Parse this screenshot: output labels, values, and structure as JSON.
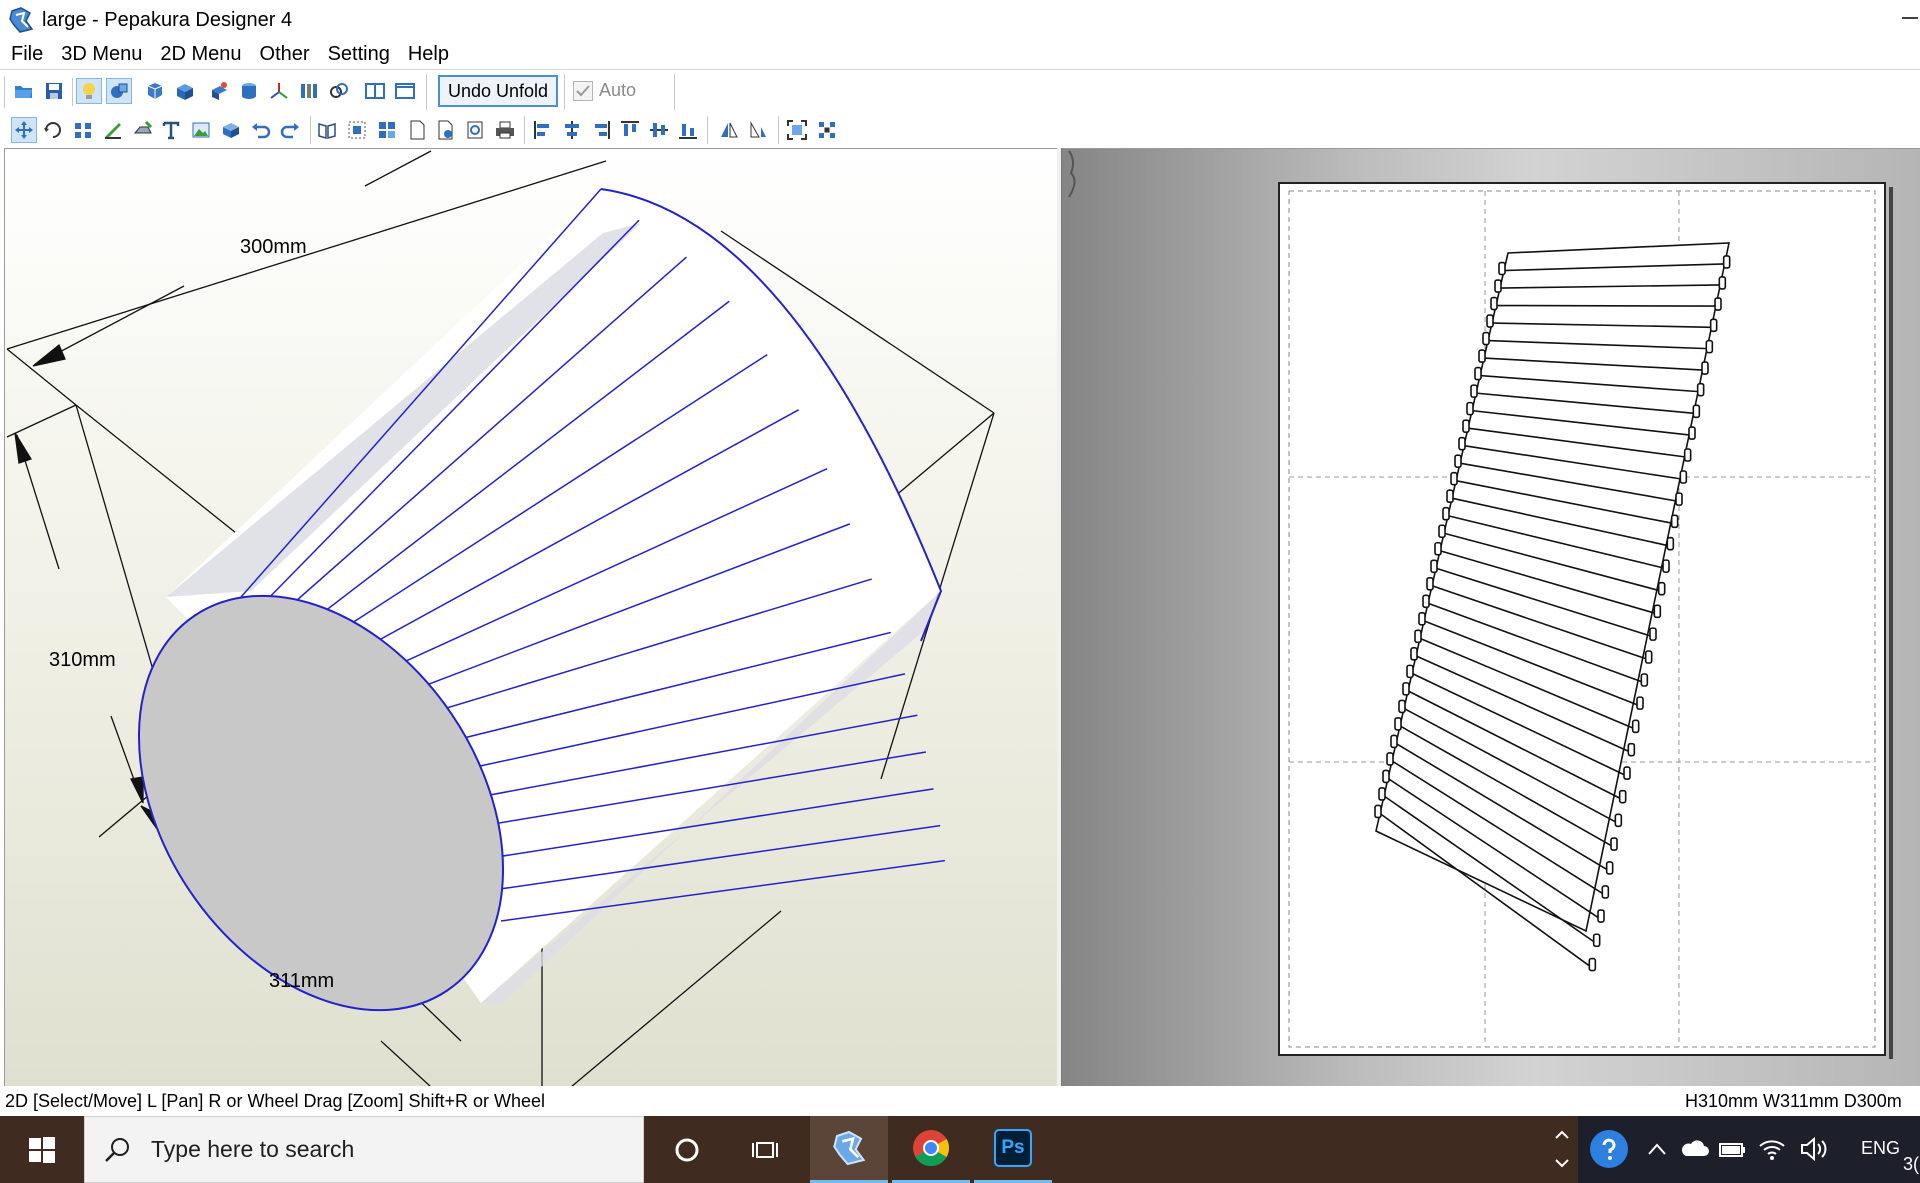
{
  "window": {
    "title": "large - Pepakura Designer 4"
  },
  "menu": [
    "File",
    "3D Menu",
    "2D Menu",
    "Other",
    "Setting",
    "Help"
  ],
  "toolbar1": {
    "undo_unfold_label": "Undo Unfold",
    "auto_label": "Auto",
    "auto_checked": true,
    "icons": [
      "open-icon",
      "save-icon",
      "light-icon",
      "textures-icon",
      "unfold-icon",
      "shading-icon",
      "fold-icon",
      "cylinder-icon",
      "axis-icon",
      "edges-icon",
      "view-link-icon",
      "split-view-icon",
      "single-view-icon"
    ]
  },
  "toolbar2": {
    "icons": [
      "select-move-icon",
      "rotate-icon",
      "join-icon",
      "edge-edit-icon",
      "flap-icon",
      "text-icon",
      "image-icon",
      "assembly-icon",
      "undo-icon",
      "redo-icon",
      "book-icon",
      "arrange-icon",
      "layout-icon",
      "page-icon",
      "page-settings-icon",
      "print-preview-icon",
      "print-icon",
      "align-left-icon",
      "align-center-icon",
      "align-right-icon",
      "align-top-icon",
      "align-middle-icon",
      "align-bottom-icon",
      "flip-h-icon",
      "flip-v-icon",
      "fit-icon",
      "zoom-all-icon"
    ]
  },
  "view3d": {
    "dimensions": {
      "depth": "300mm",
      "height": "310mm",
      "width": "311mm"
    },
    "edge_color": "#2222cc",
    "face_color": "#c8c8c8"
  },
  "view2d": {
    "strips": 33
  },
  "status": {
    "left": "2D [Select/Move] L [Pan] R or Wheel Drag [Zoom] Shift+R or Wheel",
    "right": "H310mm W311mm D300m"
  },
  "taskbar": {
    "search_placeholder": "Type here to search",
    "apps": [
      "cortana-icon",
      "task-view-icon",
      "pepakura-icon",
      "chrome-icon",
      "photoshop-icon"
    ],
    "photoshop_label": "Ps",
    "language": "ENG",
    "clock_fragment": "3("
  }
}
